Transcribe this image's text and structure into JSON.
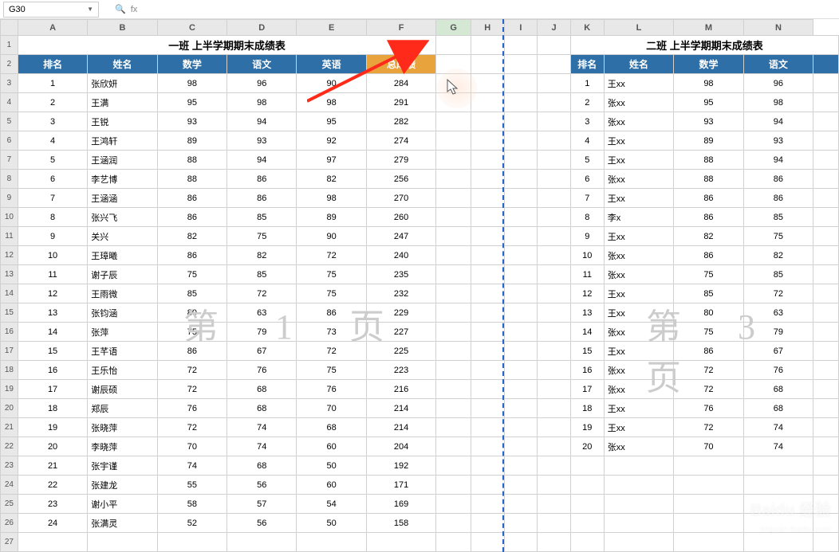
{
  "nameBox": "G30",
  "fxIcon": "fx",
  "columns": [
    "A",
    "B",
    "C",
    "D",
    "E",
    "F",
    "G",
    "H",
    "I",
    "J",
    "K",
    "L",
    "M",
    "N"
  ],
  "selectedCol": "G",
  "leftTable": {
    "title": "一班 上半学期期末成绩表",
    "headers": [
      "排名",
      "姓名",
      "数学",
      "语文",
      "英语",
      "总成绩"
    ],
    "rows": [
      [
        "1",
        "张欣妍",
        "98",
        "96",
        "90",
        "284"
      ],
      [
        "2",
        "王满",
        "95",
        "98",
        "98",
        "291"
      ],
      [
        "3",
        "王锐",
        "93",
        "94",
        "95",
        "282"
      ],
      [
        "4",
        "王鸿轩",
        "89",
        "93",
        "92",
        "274"
      ],
      [
        "5",
        "王涵润",
        "88",
        "94",
        "97",
        "279"
      ],
      [
        "6",
        "李艺博",
        "88",
        "86",
        "82",
        "256"
      ],
      [
        "7",
        "王涵涵",
        "86",
        "86",
        "98",
        "270"
      ],
      [
        "8",
        "张兴飞",
        "86",
        "85",
        "89",
        "260"
      ],
      [
        "9",
        "关兴",
        "82",
        "75",
        "90",
        "247"
      ],
      [
        "10",
        "王璋曦",
        "86",
        "82",
        "72",
        "240"
      ],
      [
        "11",
        "谢子辰",
        "75",
        "85",
        "75",
        "235"
      ],
      [
        "12",
        "王雨微",
        "85",
        "72",
        "75",
        "232"
      ],
      [
        "13",
        "张钧涵",
        "80",
        "63",
        "86",
        "229"
      ],
      [
        "14",
        "张萍",
        "75",
        "79",
        "73",
        "227"
      ],
      [
        "15",
        "王芊语",
        "86",
        "67",
        "72",
        "225"
      ],
      [
        "16",
        "王乐怡",
        "72",
        "76",
        "75",
        "223"
      ],
      [
        "17",
        "谢辰硕",
        "72",
        "68",
        "76",
        "216"
      ],
      [
        "18",
        "郑辰",
        "76",
        "68",
        "70",
        "214"
      ],
      [
        "19",
        "张晓萍",
        "72",
        "74",
        "68",
        "214"
      ],
      [
        "20",
        "李晓萍",
        "70",
        "74",
        "60",
        "204"
      ],
      [
        "21",
        "张宇谨",
        "74",
        "68",
        "50",
        "192"
      ],
      [
        "22",
        "张建龙",
        "55",
        "56",
        "60",
        "171"
      ],
      [
        "23",
        "谢小平",
        "58",
        "57",
        "54",
        "169"
      ],
      [
        "24",
        "张满灵",
        "52",
        "56",
        "50",
        "158"
      ]
    ]
  },
  "rightTable": {
    "title": "二班 上半学期期末成绩表",
    "headers": [
      "排名",
      "姓名",
      "数学",
      "语文"
    ],
    "rows": [
      [
        "1",
        "王xx",
        "98",
        "96"
      ],
      [
        "2",
        "张xx",
        "95",
        "98"
      ],
      [
        "3",
        "张xx",
        "93",
        "94"
      ],
      [
        "4",
        "王xx",
        "89",
        "93"
      ],
      [
        "5",
        "王xx",
        "88",
        "94"
      ],
      [
        "6",
        "张xx",
        "88",
        "86"
      ],
      [
        "7",
        "王xx",
        "86",
        "86"
      ],
      [
        "8",
        "李x",
        "86",
        "85"
      ],
      [
        "9",
        "王xx",
        "82",
        "75"
      ],
      [
        "10",
        "张xx",
        "86",
        "82"
      ],
      [
        "11",
        "张xx",
        "75",
        "85"
      ],
      [
        "12",
        "王xx",
        "85",
        "72"
      ],
      [
        "13",
        "王xx",
        "80",
        "63"
      ],
      [
        "14",
        "张xx",
        "75",
        "79"
      ],
      [
        "15",
        "王xx",
        "86",
        "67"
      ],
      [
        "16",
        "张xx",
        "72",
        "76"
      ],
      [
        "17",
        "张xx",
        "72",
        "68"
      ],
      [
        "18",
        "王xx",
        "76",
        "68"
      ],
      [
        "19",
        "王xx",
        "72",
        "74"
      ],
      [
        "20",
        "张xx",
        "70",
        "74"
      ]
    ]
  },
  "watermarks": {
    "page1": "第 1 页",
    "page3": "第 3 页"
  },
  "baiduLogo": "Baidu 经验",
  "baiduUrl": "jingyan.baidu.com"
}
